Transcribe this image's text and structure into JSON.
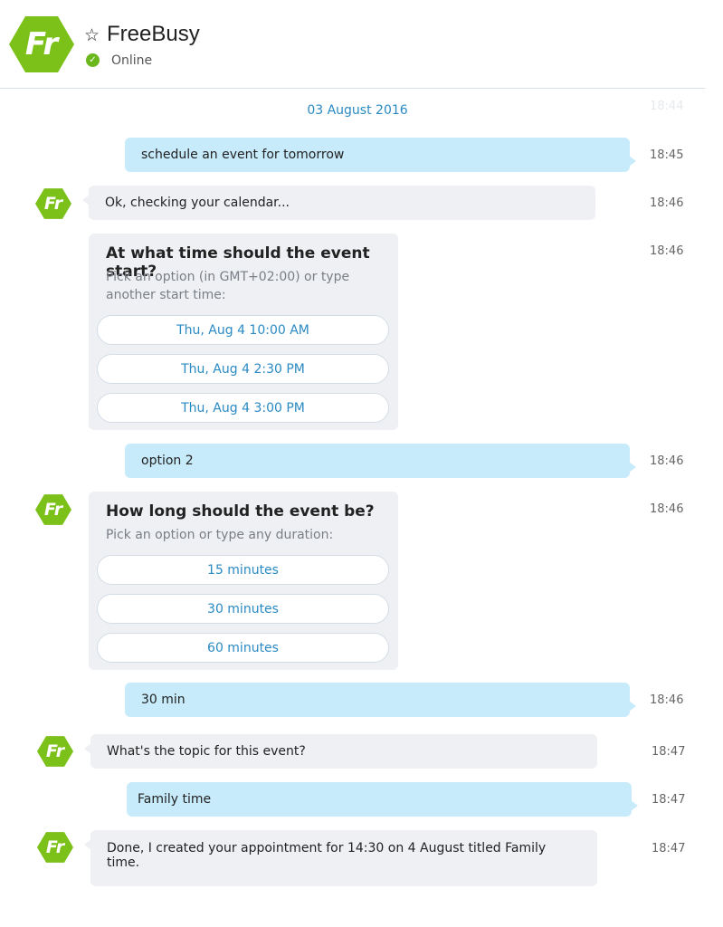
{
  "header": {
    "title": "FreeBusy",
    "status": "Online",
    "avatar_initials": "Fr",
    "favorite_icon": "star-outline-icon",
    "status_icon": "check-circle-icon"
  },
  "colors": {
    "brand_green": "#7cc11a",
    "user_bubble": "#c7ebfb",
    "bot_bubble": "#eef0f4",
    "link_blue": "#2a8ac3"
  },
  "conversation": {
    "date_separator": "03 August 2016",
    "date_time": "18:44",
    "messages": [
      {
        "text": "schedule an event for tomorrow",
        "time": "18:45"
      },
      {
        "text": "Ok, checking your calendar...",
        "time": "18:46"
      },
      {
        "question": "At what time should the event start?",
        "hint": "Pick an option (in GMT+02:00) or type another start time:",
        "options": [
          "Thu, Aug 4 10:00 AM",
          "Thu, Aug 4 2:30 PM",
          "Thu, Aug 4 3:00 PM"
        ],
        "time": "18:46"
      },
      {
        "text": "option 2",
        "time": "18:46"
      },
      {
        "question": "How long should the event be?",
        "hint": "Pick an option or type any duration:",
        "options": [
          "15 minutes",
          "30 minutes",
          "60 minutes"
        ],
        "time": "18:46"
      },
      {
        "text": "30 min",
        "time": "18:46"
      },
      {
        "text": "What's the topic for this event?",
        "time": "18:47"
      },
      {
        "text": "Family time",
        "time": "18:47"
      },
      {
        "text": "Done, I created your appointment for 14:30 on 4 August titled Family time.",
        "time": "18:47"
      }
    ]
  }
}
